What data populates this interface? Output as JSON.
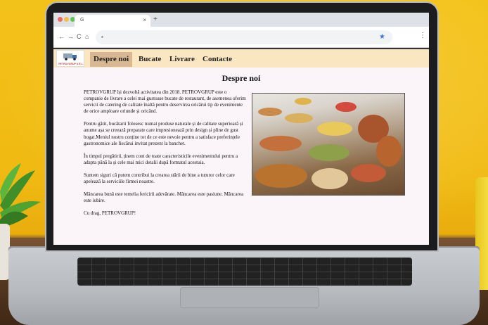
{
  "browser": {
    "tab_title": "",
    "tab_favicon": "G",
    "close_tab": "×",
    "new_tab": "+",
    "back": "←",
    "forward": "→",
    "reload": "C",
    "home": "⌂",
    "lock": "🔒",
    "bookmark": "★",
    "menu": "⋮",
    "traffic_colors": [
      "#ed6a5e",
      "#f5bf4f",
      "#61c554"
    ]
  },
  "site": {
    "logo_text": "PETROVGRUP S.R.L.",
    "nav": [
      {
        "label": "Despre noi",
        "active": true
      },
      {
        "label": "Bucate",
        "active": false
      },
      {
        "label": "Livrare",
        "active": false
      },
      {
        "label": "Contacte",
        "active": false
      }
    ],
    "page_title": "Despre noi",
    "paragraphs": [
      "PETROVGRUP își dezvoltă activitatea din 2018. PETROVGRUP este o companie de livrare a celei mai gustoase bucate de restaurant, de asemenea oferim servicii de catering de calitate înaltă pentru deservirea oricărui tip de evenimente de orice amploare oriunde și oricând.",
      "Pentru gătit, bucătarii folosesc numai produse naturale și de calitate superioară și anume așa se creează preparate care impresionează prin design și pline de gust bogat.Meniul nostru conține tot de ce este nevoie pentru a satisface preferințele gastronomice ale fiecărui invitat prezent la banchet.",
      "În timpul pregătirii, ținem cont de toate caracteristicile evenimentului pentru a adapta până la și cele mai mici detalii după formatul acestuia.",
      "Suntem siguri că putem contribui la crearea stării de bine a tuturor celor care apelează la serviciile firmei noastre.",
      "Mâncarea bună este temelia fericirii adevărate. Mâncarea este pasiune. Mâncarea este iubire.",
      "Cu drag, PETROVGRUP!"
    ]
  }
}
